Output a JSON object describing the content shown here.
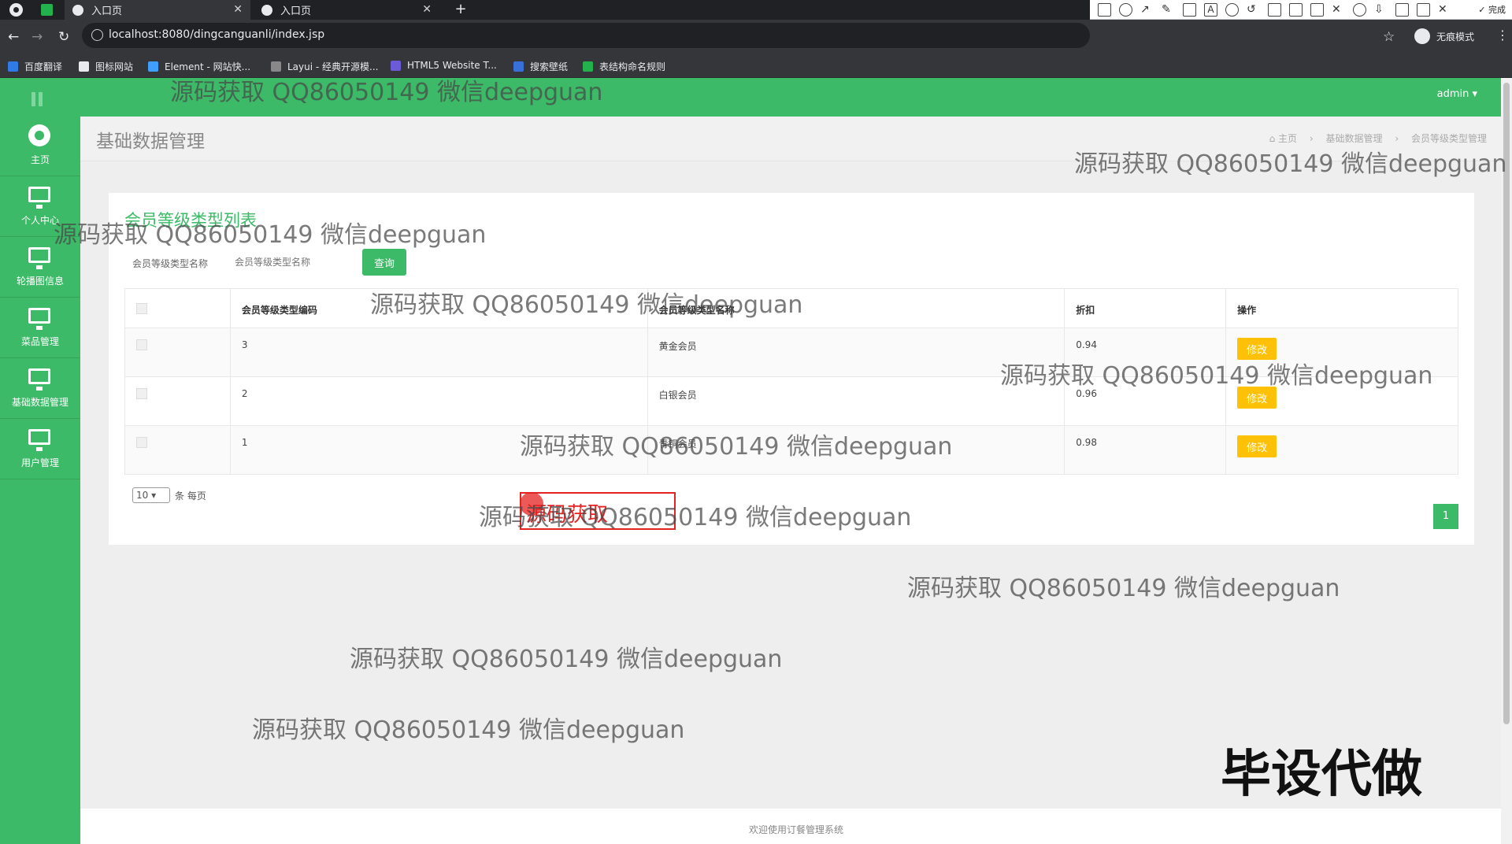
{
  "browser": {
    "tabs": [
      {
        "label": "入口页",
        "active": true
      },
      {
        "label": "入口页",
        "active": false
      }
    ],
    "url": "localhost:8080/dingcanguanli/index.jsp",
    "incognito_label": "无痕模式",
    "bookmarks": [
      "百度翻译",
      "图标网站",
      "Element - 网站快...",
      "Layui - 经典开源模...",
      "HTML5 Website T...",
      "搜索壁纸",
      "表结构命名规则"
    ]
  },
  "capture_toolbar": {
    "font_size": "20",
    "done_label": "完成",
    "current_color": "#ee3333",
    "palette": [
      "#000000",
      "#666666",
      "#8b0000",
      "#ff8800",
      "#228b22",
      "#1e90ff",
      "#8b008b",
      "#20b2aa",
      "#ffffff",
      "#cccccc",
      "#ff4444",
      "#ffff00",
      "#7cfc00",
      "#00bfff",
      "#ff00ff",
      "#40e0d0"
    ]
  },
  "header": {
    "user_label": "admin ▾"
  },
  "sidebar": {
    "items": [
      {
        "label": "主页",
        "icon": "dashboard-icon"
      },
      {
        "label": "个人中心",
        "icon": "monitor-icon"
      },
      {
        "label": "轮播图信息",
        "icon": "monitor-icon"
      },
      {
        "label": "菜品管理",
        "icon": "monitor-icon"
      },
      {
        "label": "基础数据管理",
        "icon": "monitor-icon"
      },
      {
        "label": "用户管理",
        "icon": "monitor-icon"
      }
    ]
  },
  "page": {
    "title": "基础数据管理",
    "breadcrumbs": [
      "主页",
      "基础数据管理",
      "会员等级类型管理"
    ]
  },
  "card": {
    "title": "会员等级类型列表",
    "search_label": "会员等级类型名称",
    "search_placeholder": "会员等级类型名称",
    "query_button": "查询"
  },
  "table": {
    "headers": [
      "会员等级类型编码",
      "会员等级类型名称",
      "折扣",
      "操作"
    ],
    "rows": [
      {
        "code": "3",
        "name": "黄金会员",
        "discount": "0.94",
        "action": "修改"
      },
      {
        "code": "2",
        "name": "白银会员",
        "discount": "0.96",
        "action": "修改"
      },
      {
        "code": "1",
        "name": "青铜会员",
        "discount": "0.98",
        "action": "修改"
      }
    ]
  },
  "pagination": {
    "page_size": "10",
    "page_size_suffix": "条 每页",
    "current_page": "1"
  },
  "annotation": {
    "text": "源码获取"
  },
  "footer": {
    "text": "欢迎使用订餐管理系统"
  },
  "watermarks": {
    "text": "源码获取 QQ86050149 微信deepguan",
    "big": "毕设代做"
  },
  "colors": {
    "brand_green": "#3cba67",
    "edit_yellow": "#ffc107",
    "annotation_red": "#e52222"
  }
}
